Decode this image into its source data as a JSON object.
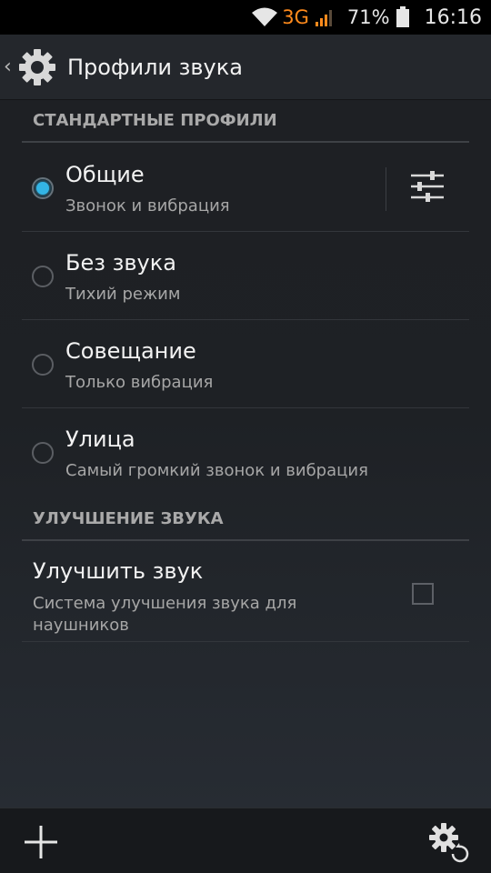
{
  "status_bar": {
    "network": "3G",
    "battery": "71%",
    "time": "16:16"
  },
  "action_bar": {
    "title": "Профили звука"
  },
  "sections": {
    "standard": {
      "header": "СТАНДАРТНЫЕ ПРОФИЛИ"
    },
    "enhancement": {
      "header": "УЛУЧШЕНИЕ ЗВУКА"
    }
  },
  "profiles": [
    {
      "title": "Общие",
      "subtitle": "Звонок и вибрация",
      "selected": true
    },
    {
      "title": "Без звука",
      "subtitle": "Тихий режим",
      "selected": false
    },
    {
      "title": "Совещание",
      "subtitle": "Только вибрация",
      "selected": false
    },
    {
      "title": "Улица",
      "subtitle": "Самый громкий звонок и вибрация",
      "selected": false
    }
  ],
  "enhance": {
    "title": "Улучшить звук",
    "subtitle": "Система улучшения звука для наушников",
    "checked": false
  },
  "icons": {
    "status": [
      "wifi-icon",
      "signal-icon",
      "battery-icon"
    ],
    "action_bar": [
      "back-caret-icon",
      "settings-gear-icon"
    ],
    "profile_settings": "sliders-icon",
    "bottom": [
      "plus-icon",
      "gear-reset-icon"
    ]
  },
  "colors": {
    "accent": "#33b5e5",
    "network": "#ff8a1c"
  }
}
